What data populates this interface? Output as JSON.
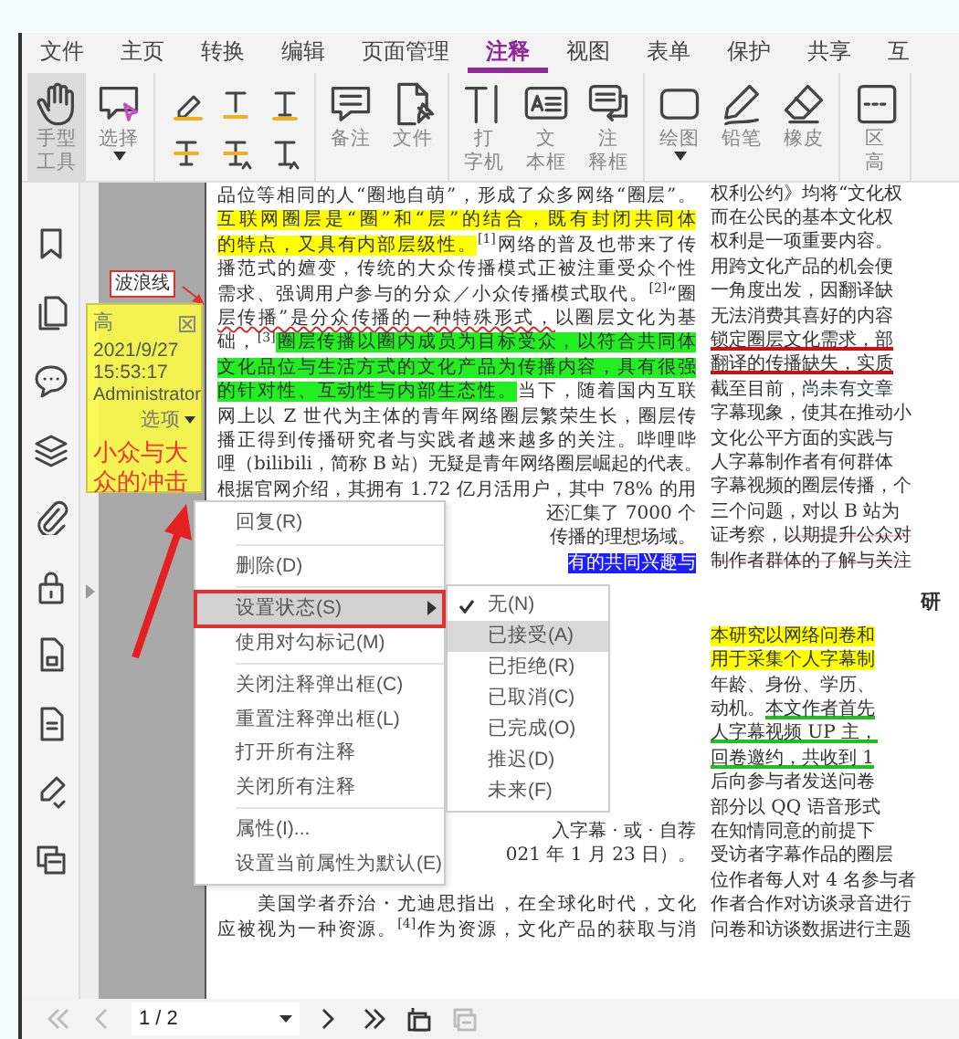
{
  "menu_tabs": [
    {
      "label": "文件",
      "selected": false
    },
    {
      "label": "主页",
      "selected": false
    },
    {
      "label": "转换",
      "selected": false
    },
    {
      "label": "编辑",
      "selected": false
    },
    {
      "label": "页面管理",
      "selected": false
    },
    {
      "label": "注释",
      "selected": true
    },
    {
      "label": "视图",
      "selected": false
    },
    {
      "label": "表单",
      "selected": false
    },
    {
      "label": "保护",
      "selected": false
    },
    {
      "label": "共享",
      "selected": false
    },
    {
      "label": "互",
      "selected": false
    }
  ],
  "tool_groups": [
    {
      "kind": "buttons",
      "tools": [
        {
          "label": [
            "手型",
            "工具"
          ],
          "selected": true,
          "dropdown": false
        },
        {
          "label": [
            "选择"
          ],
          "selected": false,
          "dropdown": true
        }
      ]
    },
    {
      "kind": "markup"
    },
    {
      "kind": "buttons",
      "tools": [
        {
          "label": [
            "备注"
          ],
          "selected": false,
          "dropdown": false
        },
        {
          "label": [
            "文件"
          ],
          "selected": false,
          "dropdown": false
        }
      ]
    },
    {
      "kind": "buttons",
      "tools": [
        {
          "label": [
            "打",
            "字机"
          ],
          "selected": false,
          "dropdown": false
        },
        {
          "label": [
            "文",
            "本框"
          ],
          "selected": false,
          "dropdown": false
        },
        {
          "label": [
            "注",
            "释框"
          ],
          "selected": false,
          "dropdown": false
        }
      ]
    },
    {
      "kind": "buttons",
      "tools": [
        {
          "label": [
            "绘图"
          ],
          "selected": false,
          "dropdown": true
        },
        {
          "label": [
            "铅笔"
          ],
          "selected": false,
          "dropdown": false
        },
        {
          "label": [
            "橡皮"
          ],
          "selected": false,
          "dropdown": false
        }
      ]
    },
    {
      "kind": "buttons",
      "tools": [
        {
          "label": [
            "区",
            "高"
          ],
          "selected": false,
          "dropdown": false
        }
      ]
    }
  ],
  "callout": {
    "text": "波浪线"
  },
  "document": {
    "column_1_top": [
      {
        "text": "品位等相同的人“圈地自萌”，形成了众多网络“圈层”。"
      },
      {
        "text": "互联网圈层是“圈”和“层”的结合，既有封闭共同体",
        "kind": "yellow"
      },
      {
        "segments": [
          {
            "text": "的特点，又具有内部层级性。",
            "kind": "yellow"
          },
          {
            "text": "$^{[1]}$网络的普及也带来了传"
          }
        ]
      },
      {
        "text": "播范式的嬗变，传统的大众传播模式正被注重受众个性"
      },
      {
        "text": "需求、强调用户参与的分众／小众传播模式取代。$^{[2]}$“圈"
      },
      {
        "segments": [
          {
            "text": "层传播”是分众传播的一种特殊形式，",
            "kind": "wavy"
          },
          {
            "text": "以圈层文化为基"
          }
        ]
      },
      {
        "segments": [
          {
            "text": "础，$^{[3]}$"
          },
          {
            "text": "圈层传播以圈内成员为目标受众，以符合共同体",
            "kind": "green"
          }
        ]
      },
      {
        "text": "文化品位与生活方式的文化产品为传播内容，具有很强",
        "kind": "green"
      },
      {
        "segments": [
          {
            "text": "的针对性、互动性与内部生态性。",
            "kind": "green"
          },
          {
            "text": "当下，随着国内互联"
          }
        ]
      },
      {
        "text": "网上以 Z 世代为主体的青年网络圈层繁荣生长，圈层传"
      },
      {
        "text": "播正得到传播研究者与实践者越来越多的关注。哔哩哔"
      },
      {
        "text": "哩（bilibili，简称 B 站）无疑是青年网络圈层崛起的代表。"
      },
      {
        "text": "根据官网介绍，其拥有 1.72 亿月活用户，其中 78% 的用"
      }
    ],
    "column_1_right_of_menu": [
      {
        "text": "还汇集了 7000 个"
      },
      {
        "text": "传播的理想场域。"
      },
      {
        "text": "有的共同兴趣与",
        "kind": "selected"
      }
    ],
    "column_1_beside_menu": [
      {
        "text": "入字幕 · 或 · 自荐"
      },
      {
        "text": "021 年 1 月 23 日）。"
      }
    ],
    "column_1_bottom": [
      {
        "text": "　　美国学者乔治・尤迪思指出，在全球化时代，文化"
      },
      {
        "text": "应被视为一种资源。$^{[4]}$作为资源，文化产品的获取与消"
      }
    ],
    "column_2_top": [
      {
        "text": "权利公约》均将“文化权"
      },
      {
        "text": "而在公民的基本文化权"
      },
      {
        "text": "权利是一项重要内容。"
      },
      {
        "text": "用跨文化产品的机会便"
      },
      {
        "text": "一角度出发，因翻译缺"
      },
      {
        "text": "无法消费其喜好的内容"
      },
      {
        "text": "锁定圈层文化需求，部",
        "kind": "red-underline"
      },
      {
        "text": "翻译的传播缺失，实质",
        "kind": "red-underline"
      },
      {
        "segments": [
          {
            "text": "截至目前，"
          },
          {
            "text": "尚未有文章",
            "kind": "teal-strike"
          }
        ]
      },
      {
        "text": "字幕现象，使其在推动小"
      },
      {
        "text": "文化公平方面的实践与"
      },
      {
        "text": "人字幕制作者有何群体"
      },
      {
        "text": "字幕视频的圈层传播，个"
      },
      {
        "text": "三个问题，对以 B 站为"
      },
      {
        "segments": [
          {
            "text": "证考察，"
          },
          {
            "text": "以期提升公众对",
            "kind": "red-strike"
          }
        ]
      },
      {
        "text": "制作者群体的了解与关注",
        "kind": "red-strike"
      }
    ],
    "column_2_heading": "研",
    "column_2_body": [
      {
        "text": "本研究以网络问卷和",
        "kind": "yellow"
      },
      {
        "text": "用于采集个人字幕制",
        "kind": "yellow"
      },
      {
        "text": "年龄、身份、学历、"
      },
      {
        "segments": [
          {
            "text": "动机。"
          },
          {
            "text": "本文作者首先",
            "kind": "green-underline"
          }
        ]
      },
      {
        "text": "人字幕视频 UP 主，",
        "kind": "green-underline"
      },
      {
        "text": "回卷邀约，共收到 1",
        "kind": "green-underline"
      },
      {
        "text": "后向参与者发送问卷"
      },
      {
        "text": "部分以 QQ 语音形式"
      },
      {
        "text": "在知情同意的前提下"
      },
      {
        "text": "受访者字幕作品的圈层"
      },
      {
        "text": "位作者每人对 4 名参与者"
      },
      {
        "text": "作者合作对访谈录音进行"
      },
      {
        "text": "问卷和访谈数据进行主题"
      }
    ]
  },
  "note": {
    "author": "高",
    "date": "2021/9/27 15:53:17",
    "user": "Administrator",
    "options": "选项",
    "content": "小众与大众的冲击"
  },
  "context_menu": [
    {
      "kind": "item",
      "label": "回复(R)",
      "selected": false,
      "submenu": false
    },
    {
      "kind": "separator"
    },
    {
      "kind": "item",
      "label": "删除(D)",
      "selected": false,
      "submenu": false
    },
    {
      "kind": "separator"
    },
    {
      "kind": "item",
      "label": "设置状态(S)",
      "selected": true,
      "submenu": true
    },
    {
      "kind": "item",
      "label": "使用对勾标记(M)",
      "selected": false,
      "submenu": false
    },
    {
      "kind": "separator"
    },
    {
      "kind": "item",
      "label": "关闭注释弹出框(C)",
      "selected": false,
      "submenu": false
    },
    {
      "kind": "item",
      "label": "重置注释弹出框(L)",
      "selected": false,
      "submenu": false
    },
    {
      "kind": "item",
      "label": "打开所有注释",
      "selected": false,
      "submenu": false
    },
    {
      "kind": "item",
      "label": "关闭所有注释",
      "selected": false,
      "submenu": false
    },
    {
      "kind": "separator"
    },
    {
      "kind": "item",
      "label": "属性(I)...",
      "selected": false,
      "submenu": false
    },
    {
      "kind": "item",
      "label": "设置当前属性为默认(E)",
      "selected": false,
      "submenu": false
    }
  ],
  "status_submenu": [
    {
      "label": "无(N)",
      "checked": true,
      "selected": false
    },
    {
      "label": "已接受(A)",
      "checked": false,
      "selected": true
    },
    {
      "label": "已拒绝(R)",
      "checked": false,
      "selected": false
    },
    {
      "label": "已取消(C)",
      "checked": false,
      "selected": false
    },
    {
      "label": "已完成(O)",
      "checked": false,
      "selected": false
    },
    {
      "label": "推迟(D)",
      "checked": false,
      "selected": false
    },
    {
      "label": "未来(F)",
      "checked": false,
      "selected": false
    }
  ],
  "nav_buttons": [
    {
      "disabled": true
    },
    {
      "disabled": true
    },
    {
      "disabled": false
    },
    {
      "disabled": false
    },
    {
      "disabled": false
    },
    {
      "disabled": true
    }
  ],
  "page_field": {
    "value": "1 / 2"
  }
}
